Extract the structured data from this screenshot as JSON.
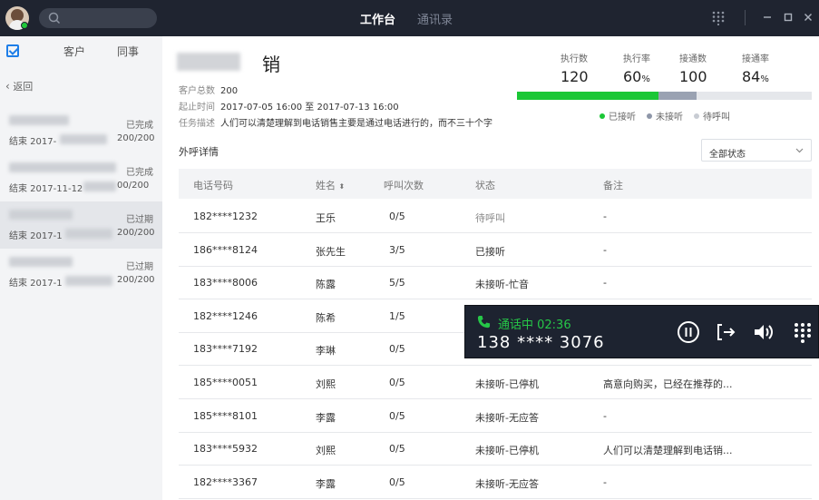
{
  "topbar": {
    "nav": [
      "工作台",
      "通讯录"
    ]
  },
  "sidebar": {
    "tabs": [
      "客户",
      "同事"
    ],
    "back_label": "返回",
    "tasks": [
      {
        "status": "已完成",
        "end": "结束 2017-",
        "count": "200/200"
      },
      {
        "status": "已完成",
        "end": "结束 2017-11-12",
        "count": "00/200"
      },
      {
        "status": "已过期",
        "end": "结束 2017-1",
        "count": "200/200"
      },
      {
        "status": "已过期",
        "end": "结束 2017-1",
        "count": "200/200"
      }
    ]
  },
  "header": {
    "title_suffix": "销",
    "meta": [
      {
        "label": "客户总数",
        "value": "200"
      },
      {
        "label": "起止时间",
        "value": "2017-07-05 16:00 至 2017-07-13 16:00"
      },
      {
        "label": "任务描述",
        "value": "人们可以清楚理解到电话销售主要是通过电话进行的，而不三十个字"
      }
    ]
  },
  "stats": [
    {
      "label": "执行数",
      "value": "120",
      "unit": ""
    },
    {
      "label": "执行率",
      "value": "60",
      "unit": "%"
    },
    {
      "label": "接通数",
      "value": "100",
      "unit": ""
    },
    {
      "label": "接通率",
      "value": "84",
      "unit": "%"
    }
  ],
  "progress": {
    "answered_fraction": 0.48,
    "unanswered_fraction": 0.13
  },
  "legend": [
    {
      "label": "已接听",
      "color": "#1bc736"
    },
    {
      "label": "未接听",
      "color": "#8e96a8"
    },
    {
      "label": "待呼叫",
      "color": "#c8ccd3"
    }
  ],
  "section_title": "外呼详情",
  "filter": {
    "value": "全部状态"
  },
  "table": {
    "headers": [
      "电话号码",
      "姓名",
      "呼叫次数",
      "状态",
      "备注"
    ],
    "rows": [
      [
        "182****1232",
        "王乐",
        "0/5",
        "待呼叫",
        "-"
      ],
      [
        "186****8124",
        "张先生",
        "3/5",
        "已接听",
        "-"
      ],
      [
        "183****8006",
        "陈露",
        "5/5",
        "未接听-忙音",
        "-"
      ],
      [
        "182****1246",
        "陈希",
        "1/5",
        "",
        ""
      ],
      [
        "183****7192",
        "李琳",
        "0/5",
        "",
        ""
      ],
      [
        "185****0051",
        "刘熙",
        "0/5",
        "未接听-已停机",
        "高意向购买，已经在推荐的..."
      ],
      [
        "185****8101",
        "李露",
        "0/5",
        "未接听-无应答",
        "-"
      ],
      [
        "183****5932",
        "刘熙",
        "0/5",
        "未接听-已停机",
        "人们可以清楚理解到电话销..."
      ],
      [
        "182****3367",
        "李露",
        "0/5",
        "未接听-无应答",
        "-"
      ]
    ]
  },
  "call": {
    "status": "通话中 02:36",
    "number": "138 **** 3076"
  },
  "colors": {
    "accent": "#1e7ee8",
    "green": "#1bc736",
    "dark": "#1f2430"
  }
}
